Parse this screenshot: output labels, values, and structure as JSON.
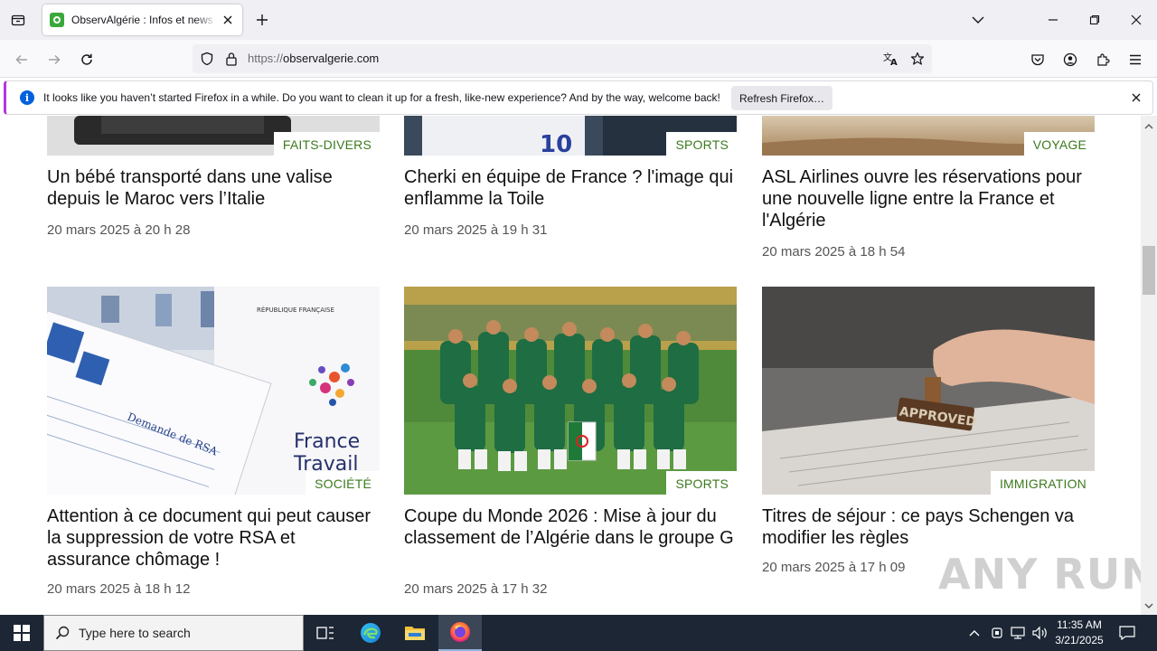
{
  "browser": {
    "tab_title": "ObservAlgérie : Infos et news pour l'Algérie",
    "url_scheme": "https://",
    "url_host": "observalgerie.com"
  },
  "notification": {
    "text": "It looks like you haven’t started Firefox in a while. Do you want to clean it up for a fresh, like-new experience? And by the way, welcome back!",
    "button_label": "Refresh Firefox…"
  },
  "articles_top": [
    {
      "category": "FAITS-DIVERS",
      "title": "Un bébé transporté dans une valise depuis le Maroc vers l’Italie",
      "date": "20 mars 2025 à 20 h 28"
    },
    {
      "category": "SPORTS",
      "title": "Cherki en équipe de France ? l'image qui enflamme la Toile",
      "date": "20 mars 2025 à 19 h 31"
    },
    {
      "category": "VOYAGE",
      "title": "ASL Airlines ouvre les réservations pour une nouvelle ligne entre la France et l'Algérie",
      "date": "20 mars 2025 à 18 h 54"
    }
  ],
  "articles_bottom": [
    {
      "category": "SOCIÉTÉ",
      "title": "Attention à ce document qui peut causer la suppression de votre RSA et assurance chômage !",
      "date": "20 mars 2025 à 18 h 12"
    },
    {
      "category": "SPORTS",
      "title": "Coupe du Monde 2026 : Mise à jour du classement de l’Algérie dans le groupe G",
      "date": "20 mars 2025 à 17 h 32"
    },
    {
      "category": "IMMIGRATION",
      "title": "Titres de séjour : ce pays Schengen va modifier les règles",
      "date": "20 mars 2025 à 17 h 09"
    }
  ],
  "image_text": {
    "rsa_form": "Demande de RSA",
    "republique": "RÉPUBLIQUE FRANÇAISE",
    "france_travail_1": "France",
    "france_travail_2": "Travail",
    "stamp": "APPROVED"
  },
  "watermark": "ANY RUN",
  "taskbar": {
    "search_placeholder": "Type here to search",
    "time": "11:35 AM",
    "date": "3/21/2025"
  }
}
